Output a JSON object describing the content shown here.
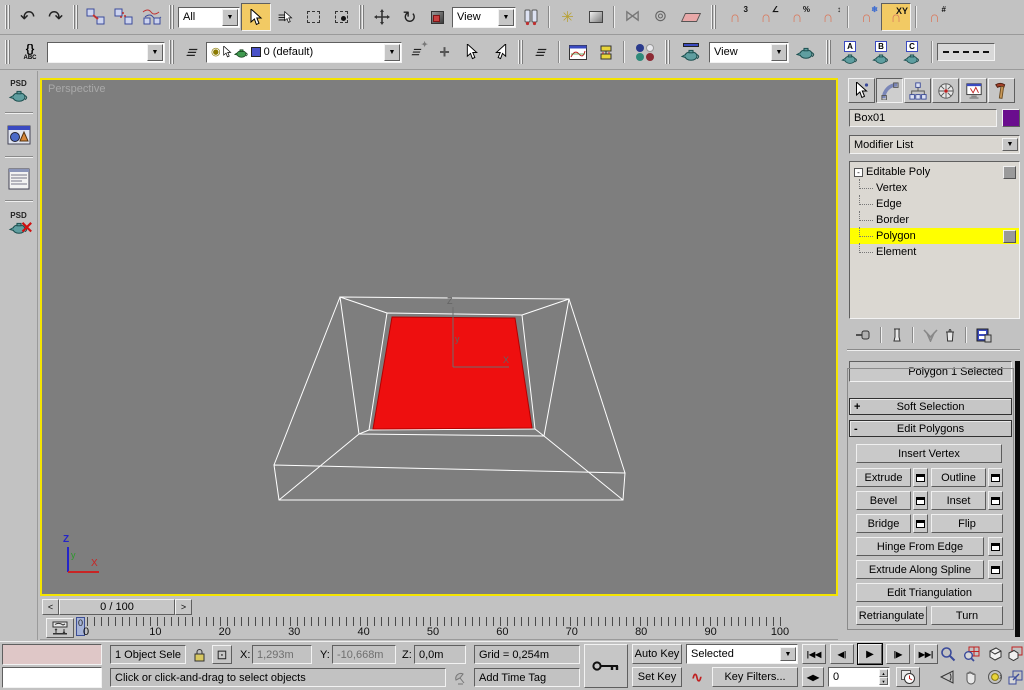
{
  "colors": {
    "viewport_bg": "#7e7e7e",
    "selection_red": "#ee0f0f",
    "active_yellow": "#f2ca64",
    "stack_highlight": "#ffff00",
    "object_color_swatch": "#6a0d8e",
    "active_border": "#f4e400"
  },
  "icons": {
    "undo": "↶",
    "redo": "↷",
    "dropdown_arrow": "▼",
    "magnet": "∩",
    "snap_3d_badge": "3",
    "snap_angle_badge": "∠",
    "snap_percent_badge": "%",
    "snap_spinner_badge": "↕",
    "snap_freeze_badge": "❄",
    "snap_xy_badge": "XY",
    "snap_grid_badge": "#",
    "mirror": "⋈",
    "array": "⊚",
    "manipulate": "✳",
    "select_by_name": "≡",
    "layers": "≡",
    "named_sel_braces": "{}",
    "named_sel_abc": "ABC",
    "eye": "◉",
    "plus": "+",
    "unlink": "⊘",
    "slider_prev": "<",
    "slider_next": ">",
    "go_start": "|◀◀",
    "frame_prev": "◀|",
    "play": "▶",
    "frame_next": "|▶",
    "go_end": "▶▶|",
    "key_mode": "◀▶",
    "curve_tangent": "∿",
    "spin_up": "▲",
    "spin_down": "▼",
    "abs_offset": "⊡"
  },
  "toolbar1": {
    "selection_filter": "All",
    "coord_system": "View"
  },
  "toolbar2": {
    "layer_current": "0 (default)",
    "render_type": "View",
    "preset_a": "A",
    "preset_b": "B",
    "preset_c": "C"
  },
  "left_toolbar": {
    "psd_render": "PSD",
    "psd_off": "PSD"
  },
  "viewport": {
    "label": "Perspective",
    "tripod": {
      "z": "Z",
      "y": "y",
      "x": "X"
    },
    "world_axis": {
      "z": "Z",
      "y": "y",
      "x": "X"
    }
  },
  "command_panel": {
    "object_name": "Box01",
    "modifier_list": "Modifier List",
    "stack": [
      {
        "label": "Editable Poly",
        "expand": "-",
        "level": 0,
        "box": true,
        "selected": false
      },
      {
        "label": "Vertex",
        "level": 1,
        "box": false,
        "selected": false
      },
      {
        "label": "Edge",
        "level": 1,
        "box": false,
        "selected": false
      },
      {
        "label": "Border",
        "level": 1,
        "box": false,
        "selected": false
      },
      {
        "label": "Polygon",
        "level": 1,
        "box": true,
        "selected": true
      },
      {
        "label": "Element",
        "level": 1,
        "box": false,
        "selected": false
      }
    ],
    "selection_status": "Polygon 1 Selected",
    "rollout_soft": {
      "state": "+",
      "label": "Soft Selection"
    },
    "rollout_edit": {
      "state": "-",
      "label": "Edit Polygons"
    },
    "buttons": {
      "insert_vertex": "Insert Vertex",
      "extrude": "Extrude",
      "outline": "Outline",
      "bevel": "Bevel",
      "inset": "Inset",
      "bridge": "Bridge",
      "flip": "Flip",
      "hinge": "Hinge From Edge",
      "extrude_spline": "Extrude Along Spline",
      "edit_triangulation": "Edit Triangulation",
      "retriangulate": "Retriangulate",
      "turn": "Turn"
    }
  },
  "timeline": {
    "slider_label": "0 / 100",
    "tick_labels": [
      "0",
      "10",
      "20",
      "30",
      "40",
      "50",
      "60",
      "70",
      "80",
      "90",
      "100"
    ],
    "current_frame_marker": "0"
  },
  "status_bar": {
    "selection_text": "1 Object Sele",
    "x_label": "X:",
    "x_value": "1,293m",
    "y_label": "Y:",
    "y_value": "-10,668m",
    "z_label": "Z:",
    "z_value": "0,0m",
    "grid_text": "Grid = 0,254m",
    "prompt": "Click or click-and-drag to select objects",
    "add_time_tag": "Add Time Tag",
    "auto_key": "Auto Key",
    "set_key": "Set Key",
    "key_filter_selection": "Selected",
    "key_filters": "Key Filters...",
    "frame_value": "0"
  }
}
